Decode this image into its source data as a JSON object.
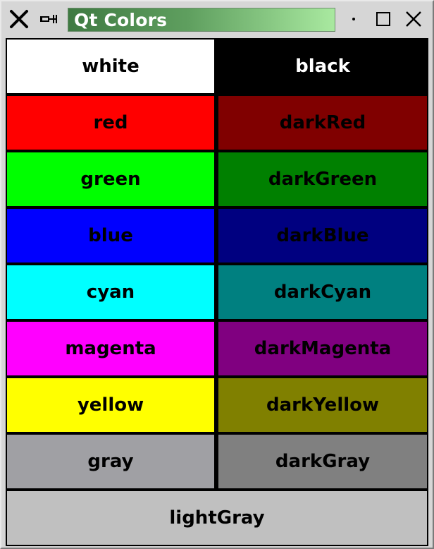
{
  "window": {
    "title": "Qt Colors",
    "controls": {
      "close_x": "close",
      "pin": "pin",
      "dot": "shade",
      "maximize": "maximize",
      "close": "close"
    }
  },
  "colors": [
    {
      "label": "white",
      "bg": "#ffffff",
      "fg": "#000000"
    },
    {
      "label": "black",
      "bg": "#000000",
      "fg": "#ffffff"
    },
    {
      "label": "red",
      "bg": "#ff0000",
      "fg": "#000000"
    },
    {
      "label": "darkRed",
      "bg": "#800000",
      "fg": "#000000"
    },
    {
      "label": "green",
      "bg": "#00ff00",
      "fg": "#000000"
    },
    {
      "label": "darkGreen",
      "bg": "#008000",
      "fg": "#000000"
    },
    {
      "label": "blue",
      "bg": "#0000ff",
      "fg": "#000000"
    },
    {
      "label": "darkBlue",
      "bg": "#000080",
      "fg": "#000000"
    },
    {
      "label": "cyan",
      "bg": "#00ffff",
      "fg": "#000000"
    },
    {
      "label": "darkCyan",
      "bg": "#008080",
      "fg": "#000000"
    },
    {
      "label": "magenta",
      "bg": "#ff00ff",
      "fg": "#000000"
    },
    {
      "label": "darkMagenta",
      "bg": "#800080",
      "fg": "#000000"
    },
    {
      "label": "yellow",
      "bg": "#ffff00",
      "fg": "#000000"
    },
    {
      "label": "darkYellow",
      "bg": "#808000",
      "fg": "#000000"
    },
    {
      "label": "gray",
      "bg": "#a0a0a4",
      "fg": "#000000"
    },
    {
      "label": "darkGray",
      "bg": "#808080",
      "fg": "#000000"
    },
    {
      "label": "lightGray",
      "bg": "#c0c0c0",
      "fg": "#000000",
      "full": true
    }
  ]
}
